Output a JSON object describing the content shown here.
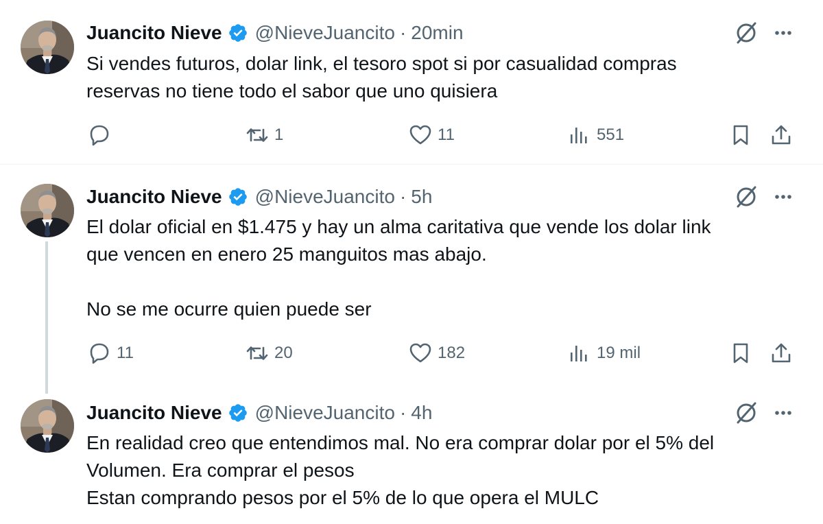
{
  "colors": {
    "text": "#0f1419",
    "muted": "#536471",
    "verified": "#1d9bf0",
    "divider": "#eff3f4",
    "thread": "#cfd9de"
  },
  "tweets": [
    {
      "name": "Juancito Nieve",
      "handle": "@NieveJuancito",
      "separator": "·",
      "time": "20min",
      "lines": [
        "Si vendes futuros, dolar link, el tesoro spot si por casualidad compras",
        "reservas no tiene todo el sabor que uno quisiera"
      ],
      "replies": "",
      "retweets": "1",
      "likes": "11",
      "views": "551"
    },
    {
      "name": "Juancito Nieve",
      "handle": "@NieveJuancito",
      "separator": "·",
      "time": "5h",
      "lines": [
        "El dolar oficial en $1.475 y hay un alma caritativa que vende los dolar link",
        "que vencen en enero 25 manguitos mas abajo."
      ],
      "extra_line": "No se me ocurre quien puede ser",
      "replies": "11",
      "retweets": "20",
      "likes": "182",
      "views": "19 mil"
    },
    {
      "name": "Juancito Nieve",
      "handle": "@NieveJuancito",
      "separator": "·",
      "time": "4h",
      "lines": [
        "En realidad creo que entendimos mal. No era comprar dolar por el 5% del",
        "Volumen. Era comprar el pesos",
        "Estan comprando pesos por el 5% de lo que opera el MULC"
      ]
    }
  ],
  "icons": {
    "avatar": "profile-photo",
    "verified": "verified-badge-icon",
    "grok": "grok-icon",
    "more": "more-icon",
    "reply": "reply-icon",
    "retweet": "retweet-icon",
    "like": "heart-icon",
    "views": "views-icon",
    "bookmark": "bookmark-icon",
    "share": "share-icon"
  }
}
